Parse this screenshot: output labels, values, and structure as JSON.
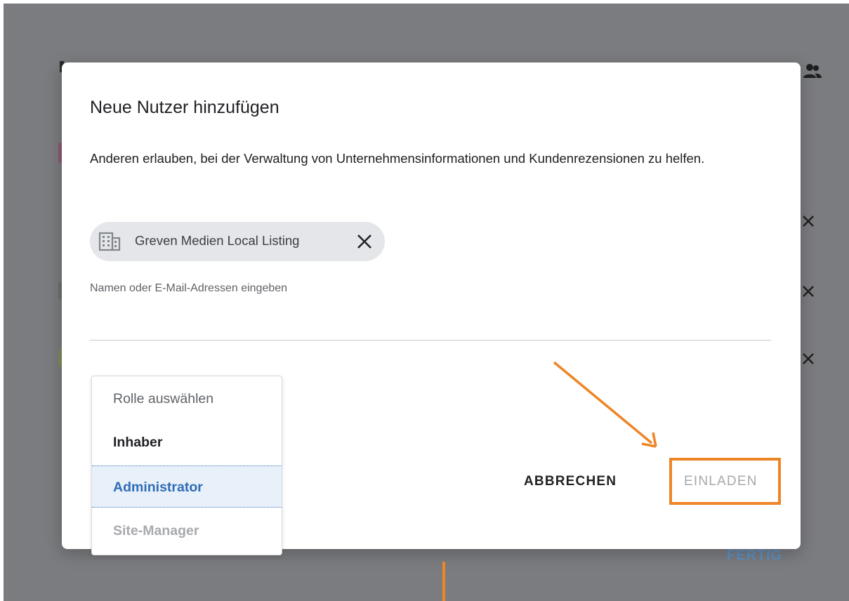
{
  "dialog": {
    "title": "Neue Nutzer hinzufügen",
    "description": "Anderen erlauben, bei der Verwaltung von Unternehmensinformationen und Kundenrezensionen zu helfen.",
    "chip": {
      "icon": "building-icon",
      "label": "Greven Medien Local Listing",
      "close_icon": "close-icon"
    },
    "email_input": {
      "placeholder": "Namen oder E-Mail-Adressen eingeben",
      "value": ""
    },
    "role_menu": {
      "header": "Rolle auswählen",
      "options": [
        "Inhaber",
        "Administrator",
        "Site-Manager"
      ],
      "selected": "Administrator"
    },
    "buttons": {
      "cancel": "ABBRECHEN",
      "invite": "EINLADEN"
    }
  },
  "background": {
    "done_label": "FERTIG",
    "icons": [
      "people-icon",
      "close-icon",
      "close-icon",
      "close-icon"
    ]
  },
  "colors": {
    "backdrop": "#7b7c7f",
    "accent_blue": "#2f6db5",
    "selection_bg": "#e8f0fa",
    "annotation_orange": "#ee8527",
    "disabled_text": "#a6a8ab"
  }
}
